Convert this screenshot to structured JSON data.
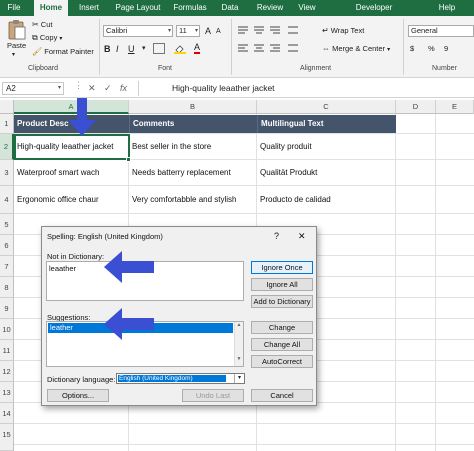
{
  "ribbon": {
    "tabs": [
      "File",
      "Home",
      "Insert",
      "Page Layout",
      "Formulas",
      "Data",
      "Review",
      "View",
      "Developer",
      "Help"
    ],
    "active_tab": "Home",
    "clipboard": {
      "paste": "Paste",
      "cut": "Cut",
      "copy": "Copy",
      "format_painter": "Format Painter",
      "label": "Clipboard"
    },
    "font": {
      "name": "Calibri",
      "size": "11",
      "bold": "B",
      "italic": "I",
      "underline": "U",
      "grow": "A",
      "shrink": "A",
      "font_color": "A",
      "label": "Font"
    },
    "alignment": {
      "wrap_text": "Wrap Text",
      "merge_center": "Merge & Center",
      "label": "Alignment"
    },
    "number": {
      "format": "General",
      "currency": "$",
      "percent": "%",
      "comma": "9",
      "label": "Number"
    }
  },
  "formula_bar": {
    "name_box": "A2",
    "fx": "fx",
    "cancel": "✕",
    "enter": "✓",
    "content": "High-quality leaather jacket"
  },
  "grid": {
    "columns": [
      "A",
      "B",
      "C",
      "D",
      "E"
    ],
    "rows": [
      "1",
      "2",
      "3",
      "4",
      "5",
      "6",
      "7",
      "8",
      "9",
      "10",
      "11",
      "12",
      "13",
      "14",
      "15"
    ],
    "header_row": [
      "Product Desc",
      "Comments",
      "Multilingual Text"
    ],
    "data": [
      [
        "High-quality leaather jacket",
        "Best seller in the store",
        "Quality produit"
      ],
      [
        "Waterproof smart wach",
        "Needs batterry replacement",
        "Qualität Produkt"
      ],
      [
        "Ergonomic office chaur",
        "Very comfortabble and stylish",
        "Producto de calidad"
      ]
    ]
  },
  "dialog": {
    "title": "Spelling: English (United Kingdom)",
    "help": "?",
    "close": "✕",
    "not_in_dictionary_label": "Not in Dictionary:",
    "not_in_dictionary_value": "leaather",
    "suggestions_label": "Suggestions:",
    "suggestions": [
      "leather"
    ],
    "dictionary_language_label": "Dictionary language:",
    "dictionary_language_value": "English (United Kingdom)",
    "buttons": {
      "ignore_once": "Ignore Once",
      "ignore_all": "Ignore All",
      "add_to_dictionary": "Add to Dictionary",
      "change": "Change",
      "change_all": "Change All",
      "autocorrect": "AutoCorrect",
      "options": "Options...",
      "undo_last": "Undo Last",
      "cancel": "Cancel"
    }
  },
  "colors": {
    "ribbon_green": "#1e6e42",
    "header_fill": "#44546a",
    "selection": "#0078d7",
    "annotation_arrow": "#3a4fd1"
  }
}
